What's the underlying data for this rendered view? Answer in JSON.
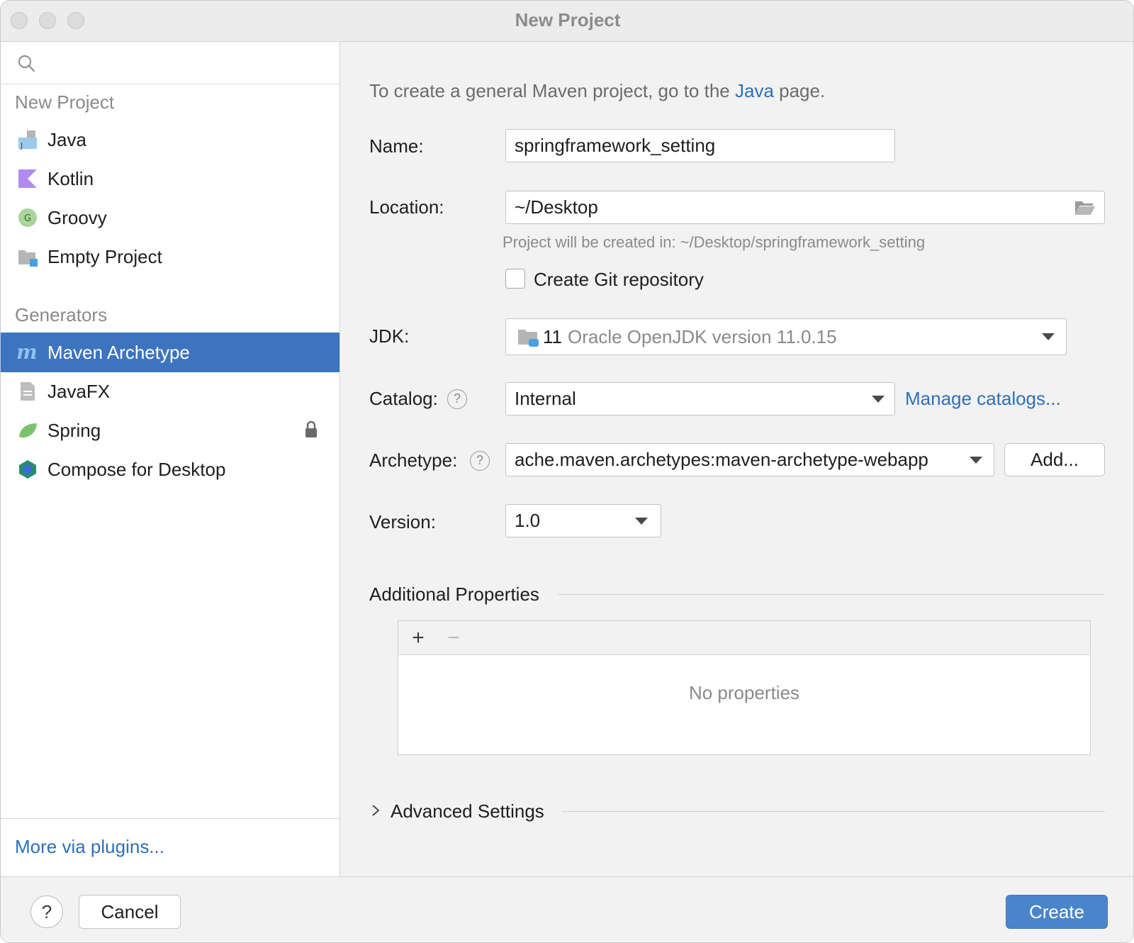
{
  "window": {
    "title": "New Project"
  },
  "sidebar": {
    "new_project_header": "New Project",
    "new_project_items": [
      {
        "label": "Java",
        "icon": "java-icon"
      },
      {
        "label": "Kotlin",
        "icon": "kotlin-icon"
      },
      {
        "label": "Groovy",
        "icon": "groovy-icon"
      },
      {
        "label": "Empty Project",
        "icon": "empty-project-icon"
      }
    ],
    "generators_header": "Generators",
    "generator_items": [
      {
        "label": "Maven Archetype",
        "icon": "maven-icon",
        "selected": true
      },
      {
        "label": "JavaFX",
        "icon": "javafx-icon"
      },
      {
        "label": "Spring",
        "icon": "spring-icon",
        "locked": true
      },
      {
        "label": "Compose for Desktop",
        "icon": "compose-icon"
      }
    ],
    "more_plugins": "More via plugins..."
  },
  "main": {
    "intro_prefix": "To create a general Maven project, go to the ",
    "intro_link": "Java",
    "intro_suffix": " page.",
    "name_label": "Name:",
    "name_value": "springframework_setting",
    "location_label": "Location:",
    "location_value": "~/Desktop",
    "location_hint": "Project will be created in: ~/Desktop/springframework_setting",
    "git_label": "Create Git repository",
    "git_checked": false,
    "jdk_label": "JDK:",
    "jdk_version": "11",
    "jdk_name": "Oracle OpenJDK version 11.0.15",
    "catalog_label": "Catalog:",
    "catalog_value": "Internal",
    "manage_catalogs": "Manage catalogs...",
    "archetype_label": "Archetype:",
    "archetype_value": "ache.maven.archetypes:maven-archetype-webapp",
    "add_button": "Add...",
    "version_label": "Version:",
    "version_value": "1.0",
    "additional_properties": "Additional Properties",
    "add_prop": "+",
    "remove_prop": "−",
    "no_properties": "No properties",
    "advanced_settings": "Advanced Settings"
  },
  "footer": {
    "help": "?",
    "cancel": "Cancel",
    "create": "Create"
  },
  "colors": {
    "accent": "#3d74bf",
    "link": "#2f6fb8",
    "primary_button": "#4a85cc"
  }
}
